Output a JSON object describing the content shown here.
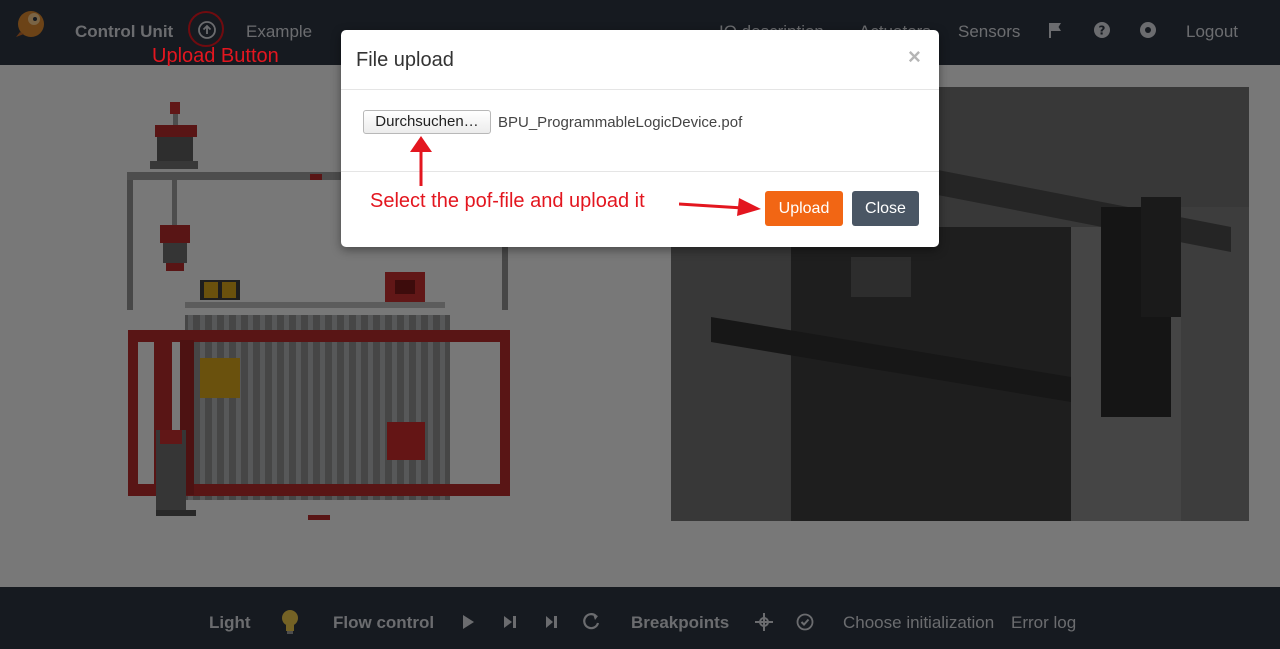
{
  "header": {
    "app_title": "Control Unit",
    "nav_example": "Example",
    "nav_io": "IO description",
    "nav_actuators": "Actuators",
    "nav_sensors": "Sensors",
    "nav_logout": "Logout",
    "icons": [
      "logo-icon",
      "upload-icon",
      "flag-icon",
      "help-icon",
      "settings-icon"
    ]
  },
  "annotations": {
    "upload_label": "Upload Button",
    "select_instruction": "Select the pof-file and upload it",
    "color": "#e3161f"
  },
  "modal": {
    "title": "File upload",
    "close_symbol": "×",
    "browse_label": "Durchsuchen…",
    "file_name": "BPU_ProgrammableLogicDevice.pof",
    "upload_label": "Upload",
    "close_label": "Close",
    "upload_color": "#f26614",
    "close_color": "#4a5664"
  },
  "toolbar": {
    "light": "Light",
    "flow_control": "Flow control",
    "breakpoints": "Breakpoints",
    "choose_init": "Choose initialization",
    "error_log": "Error log",
    "icons": [
      "lightbulb-icon",
      "play-icon",
      "step-icon",
      "step-end-icon",
      "reset-icon",
      "crosshair-icon",
      "check-circle-icon"
    ]
  },
  "colors": {
    "navbar": "#2c3440",
    "nav_text": "#d6d9de"
  }
}
